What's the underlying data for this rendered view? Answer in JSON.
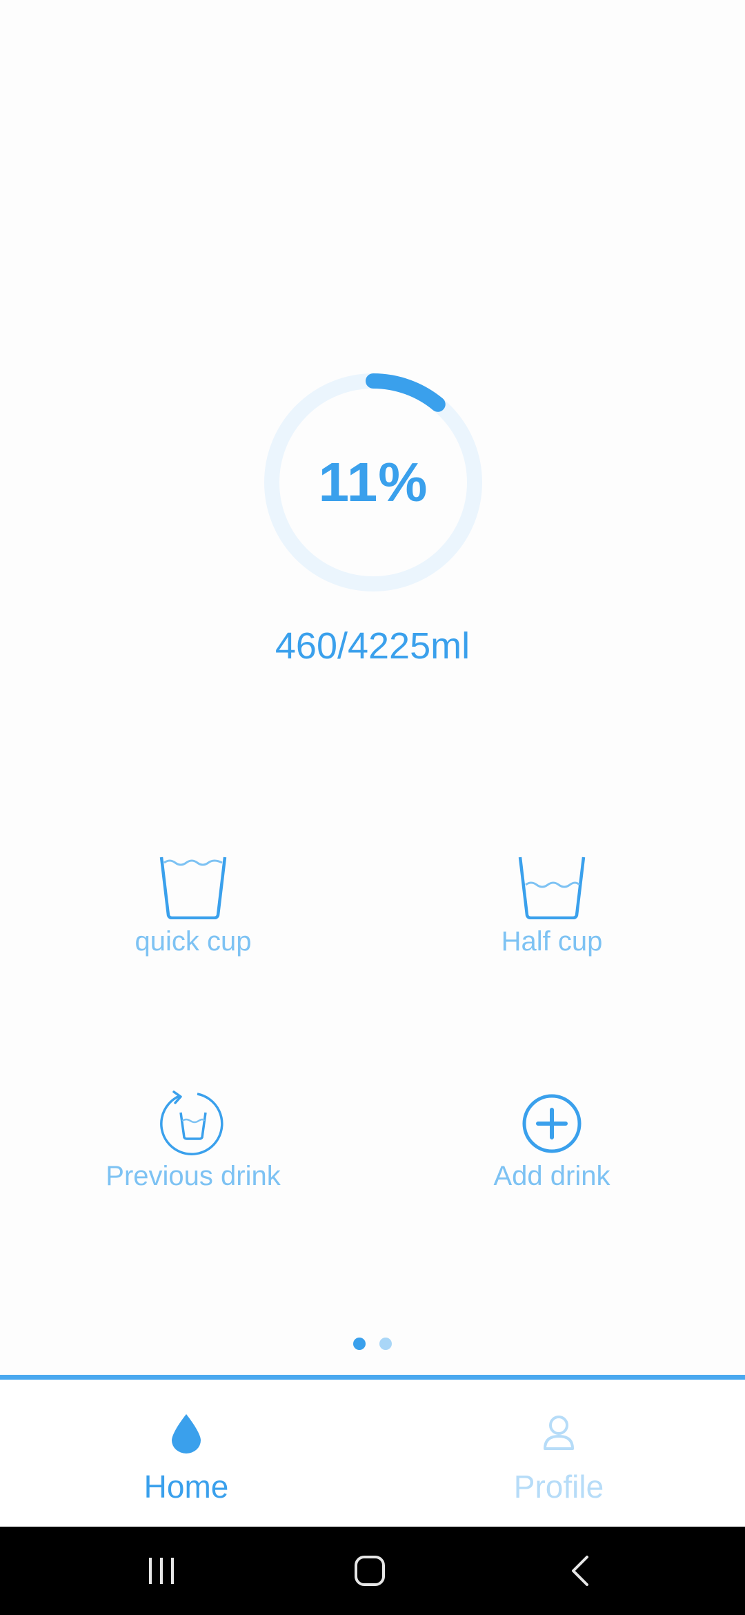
{
  "progress": {
    "percent_label": "11%",
    "fraction": 0.11,
    "volume_label": "460/4225ml"
  },
  "actions": {
    "quick_cup": {
      "label": "quick cup",
      "icon": "glass-full-icon"
    },
    "half_cup": {
      "label": "Half cup",
      "icon": "glass-half-icon"
    },
    "previous_drink": {
      "label": "Previous drink",
      "icon": "refresh-glass-icon"
    },
    "add_drink": {
      "label": "Add drink",
      "icon": "plus-circle-icon"
    }
  },
  "pager": {
    "pages": 2,
    "current": 1
  },
  "bottom_nav": {
    "home": {
      "label": "Home",
      "icon": "water-drop-icon"
    },
    "profile": {
      "label": "Profile",
      "icon": "person-icon"
    }
  },
  "colors": {
    "accent": "#3aa0ec",
    "accent_light": "#7dc2f3",
    "ring_track": "#ebf5fd",
    "inactive": "#b6dcf8"
  }
}
